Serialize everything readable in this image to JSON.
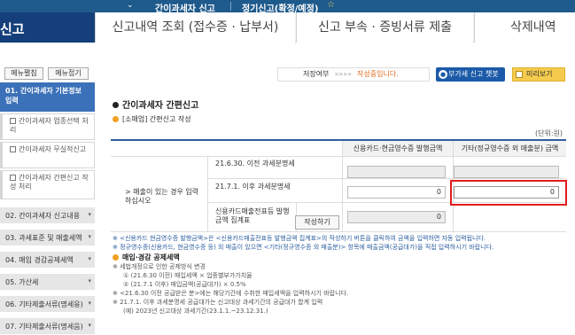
{
  "topbar": {
    "title1": "간이과세자 신고",
    "title2": "정기신고(확정/예정)"
  },
  "tabs": {
    "active": "신고",
    "items": [
      "신고내역 조회 (접수증 · 납부서)",
      "신고 부속 · 증빙서류 제출",
      "삭제내역"
    ]
  },
  "menu": {
    "expand_btn": "메뉴펼침",
    "collapse_btn": "메뉴접기",
    "head": "01. 간이과세자 기본정보 입력",
    "subs": [
      "간이과세자 업종선택 처리",
      "간이과세자 무실적신고",
      "간이과세자 간편신고 작성 처리"
    ],
    "items": [
      "02. 간이과세자 신고내용",
      "03. 과세표준 및 매출세액",
      "04. 매입 경감공제세액",
      "05. 가산세",
      "06. 기타제출서류(명세응)",
      "07. 기타제출서류(명세음)"
    ]
  },
  "header": {
    "status_label": "저장여부",
    "dots": "»»»»",
    "status_value": "작성중입니다.",
    "guide_button": "부가세 신고 챗봇",
    "preview_button": "미리보기"
  },
  "section": {
    "title": "간이과세자 간편신고",
    "subtitle": "[소매업] 간편신고 작성",
    "unit": "(단위:원)"
  },
  "table": {
    "col_card": "신용카드·현금영수증 발행금액",
    "col_other": "기타(정규영수증 외 매출분) 금액",
    "row_label": "> 매출이 있는 경우 입력하십시오",
    "sub1": "21.6.30. 이전 과세분명세",
    "sub2": "21.7.1. 이후 과세분명세",
    "sub3": "신용카드매출전표등 발행금액 집계표",
    "calc_button": "작성하기",
    "val_card": "0",
    "val_other": "0",
    "val_card2": "0"
  },
  "notes": {
    "line1": "※ <신용카드 현금영수증 발행금액>은 <신용카드매출전표등 발행금액 집계표>의 작성하기 버튼을 클릭하여 금액을 입력하면 자동 입력됩니다.",
    "line2": "※ 정규영수증(신용카드, 현금영수증 등) 외 매출이 있으면 <기타(정규영수증 외 매출분)> 항목에 매출금액(공급대가)을 직접 입력하시기 바랍니다.",
    "sect": "매입·경감 공제세액",
    "l3": "※ 세법개정으로 인한 공제방식 변경",
    "l4": "① (21.6.30 이전) 매입세액 × 업종별부가가치율",
    "l5": "② (21.7.1 이후) 매입금액(공급대가) × 0.5%",
    "l6": "※ <21.6.30 이전 공급받은 분>에는 해당기간에 수취한 매입세액을 입력하시기 바랍니다.",
    "l7": "※ 21.7.1. 이후 과세분명세 공급대가는 신고대상 과세기간의 공급대가 합계 입력",
    "l8": "(예) 2023년 신고대상 과세기간(23.1.1.~23.12.31.)"
  }
}
